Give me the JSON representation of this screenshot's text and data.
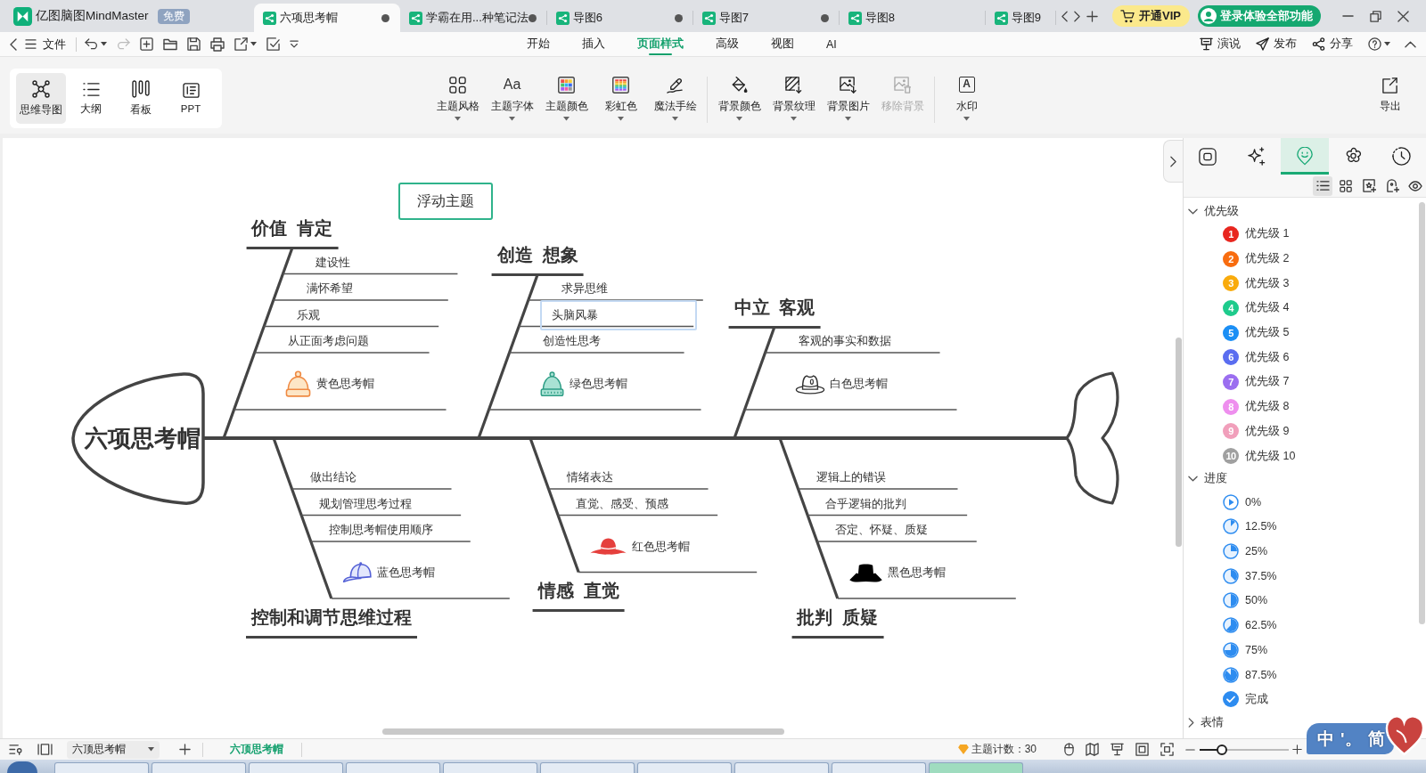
{
  "title_bar": {
    "app": {
      "name": "亿图脑图MindMaster",
      "badge": "免费"
    },
    "tabs": [
      {
        "label": "六项思考帽",
        "selected": true,
        "modified": true
      },
      {
        "label": "学霸在用...种笔记法",
        "selected": false,
        "modified": true
      },
      {
        "label": "导图6",
        "selected": false,
        "modified": true
      },
      {
        "label": "导图7",
        "selected": false,
        "modified": true
      },
      {
        "label": "导图8",
        "selected": false,
        "modified": false
      },
      {
        "label": "导图9",
        "selected": false,
        "modified": false
      }
    ],
    "vip_button": "开通VIP",
    "login_button": "登录体验全部功能"
  },
  "menu_bar": {
    "file_menu": "文件",
    "quick_actions": [
      {
        "disabled": false
      },
      {
        "disabled": true
      },
      {
        "disabled": false
      },
      {
        "disabled": false
      },
      {
        "disabled": false
      },
      {
        "disabled": false
      },
      {
        "disabled": false
      },
      {
        "disabled": false
      }
    ],
    "tabs": [
      {
        "label": "开始",
        "selected": false
      },
      {
        "label": "插入",
        "selected": false
      },
      {
        "label": "页面样式",
        "selected": true
      },
      {
        "label": "高级",
        "selected": false
      },
      {
        "label": "视图",
        "selected": false
      },
      {
        "label": "AI",
        "selected": false
      }
    ],
    "actions": [
      "演说",
      "发布",
      "分享"
    ]
  },
  "ribbon": {
    "views": [
      {
        "label": "思维导图",
        "selected": true
      },
      {
        "label": "大纲",
        "selected": false
      },
      {
        "label": "看板",
        "selected": false
      },
      {
        "label": "PPT",
        "selected": false
      }
    ],
    "tool_groups": [
      [
        {
          "label": "主题风格",
          "dropdown": true,
          "disabled": false
        },
        {
          "label": "主题字体",
          "glyph": "Aa",
          "dropdown": true,
          "disabled": false
        },
        {
          "label": "主题颜色",
          "dropdown": true,
          "disabled": false
        },
        {
          "label": "彩虹色",
          "dropdown": true,
          "disabled": false
        },
        {
          "label": "魔法手绘",
          "dropdown": true,
          "disabled": false
        }
      ],
      [
        {
          "label": "背景颜色",
          "dropdown": true,
          "disabled": false
        },
        {
          "label": "背景纹理",
          "dropdown": true,
          "disabled": false
        },
        {
          "label": "背景图片",
          "dropdown": true,
          "disabled": false
        },
        {
          "label": "移除背景",
          "dropdown": false,
          "disabled": true
        }
      ],
      [
        {
          "label": "水印",
          "glyph": "A",
          "dropdown": true,
          "disabled": false
        }
      ]
    ],
    "export": "导出"
  },
  "mind_map": {
    "central_topic": "六项思考帽",
    "floating_topic": "浮动主题",
    "branches": [
      {
        "title": "价值  肯定",
        "selected": false,
        "items": [
          {
            "kind": "text",
            "label": "建设性",
            "selected": false
          },
          {
            "kind": "text",
            "label": "满怀希望",
            "selected": false
          },
          {
            "kind": "text",
            "label": "乐观",
            "selected": false
          },
          {
            "kind": "text",
            "label": "从正面考虑问题",
            "selected": false
          },
          {
            "kind": "hat",
            "label": "黄色思考帽",
            "selected": false
          }
        ]
      },
      {
        "title": "控制和调节思维过程",
        "selected": false,
        "items": [
          {
            "kind": "text",
            "label": "做出结论",
            "selected": false
          },
          {
            "kind": "text",
            "label": "规划管理思考过程",
            "selected": false
          },
          {
            "kind": "text",
            "label": "控制思考帽使用顺序",
            "selected": false
          },
          {
            "kind": "hat",
            "label": "蓝色思考帽",
            "selected": false
          }
        ]
      },
      {
        "title": "创造  想象",
        "selected": false,
        "items": [
          {
            "kind": "text",
            "label": "求异思维",
            "selected": false
          },
          {
            "kind": "text",
            "label": "头脑风暴",
            "selected": true
          },
          {
            "kind": "text",
            "label": "创造性思考",
            "selected": false
          },
          {
            "kind": "hat",
            "label": "绿色思考帽",
            "selected": false
          }
        ]
      },
      {
        "title": "情感  直觉",
        "selected": false,
        "items": [
          {
            "kind": "text",
            "label": "情绪表达",
            "selected": false
          },
          {
            "kind": "text",
            "label": "直觉、感受、预感",
            "selected": false
          },
          {
            "kind": "hat",
            "label": "红色思考帽",
            "selected": false
          }
        ]
      },
      {
        "title": "中立  客观",
        "selected": false,
        "items": [
          {
            "kind": "text",
            "label": "客观的事实和数据",
            "selected": false
          },
          {
            "kind": "hat",
            "label": "白色思考帽",
            "selected": false
          }
        ]
      },
      {
        "title": "批判  质疑",
        "selected": false,
        "items": [
          {
            "kind": "text",
            "label": "逻辑上的错误",
            "selected": false
          },
          {
            "kind": "text",
            "label": "合乎逻辑的批判",
            "selected": false
          },
          {
            "kind": "text",
            "label": "否定、怀疑、质疑",
            "selected": false
          },
          {
            "kind": "hat",
            "label": "黑色思考帽",
            "selected": false
          }
        ]
      }
    ]
  },
  "side_panel": {
    "tabs": [
      {
        "selected": false
      },
      {
        "selected": false
      },
      {
        "selected": true
      },
      {
        "selected": false
      },
      {
        "selected": false
      }
    ],
    "view_buttons": [
      {
        "selected": true
      },
      {
        "selected": false
      },
      {
        "selected": false
      },
      {
        "selected": false
      },
      {
        "selected": false
      }
    ],
    "groups": [
      {
        "title": "优先级",
        "expanded": true,
        "items": [
          {
            "kind": "priority",
            "badge": "1",
            "label": "优先级 1",
            "color": "#e8261f"
          },
          {
            "kind": "priority",
            "badge": "2",
            "label": "优先级 2",
            "color": "#f86c0f"
          },
          {
            "kind": "priority",
            "badge": "3",
            "label": "优先级 3",
            "color": "#f9ab0c"
          },
          {
            "kind": "priority",
            "badge": "4",
            "label": "优先级 4",
            "color": "#1ecb8c"
          },
          {
            "kind": "priority",
            "badge": "5",
            "label": "优先级 5",
            "color": "#1b8ff5"
          },
          {
            "kind": "priority",
            "badge": "6",
            "label": "优先级 6",
            "color": "#5a6df0"
          },
          {
            "kind": "priority",
            "badge": "7",
            "label": "优先级 7",
            "color": "#9b6ef0"
          },
          {
            "kind": "priority",
            "badge": "8",
            "label": "优先级 8",
            "color": "#ee8fee"
          },
          {
            "kind": "priority",
            "badge": "9",
            "label": "优先级 9",
            "color": "#f19fbb"
          },
          {
            "kind": "priority",
            "badge": "10",
            "label": "优先级 10",
            "color": "#a0a0a0"
          }
        ]
      },
      {
        "title": "进度",
        "expanded": true,
        "items": [
          {
            "kind": "start",
            "label": "0%"
          },
          {
            "kind": "pie",
            "label": "12.5%"
          },
          {
            "kind": "pie",
            "label": "25%"
          },
          {
            "kind": "pie",
            "label": "37.5%"
          },
          {
            "kind": "pie",
            "label": "50%"
          },
          {
            "kind": "pie",
            "label": "62.5%"
          },
          {
            "kind": "pie",
            "label": "75%"
          },
          {
            "kind": "pie",
            "label": "87.5%"
          },
          {
            "kind": "done",
            "label": "完成"
          }
        ]
      },
      {
        "title": "表情",
        "expanded": false
      }
    ]
  },
  "status_bar": {
    "sheet_menu": "六顶思考帽",
    "sheets": [
      {
        "label": "六顶思考帽",
        "selected": true
      }
    ],
    "topic_count": "主题计数：30",
    "zoom": {
      "level": 0.25
    }
  },
  "ime_toolbar": {
    "buttons": [
      "中",
      "'。",
      "简"
    ]
  }
}
